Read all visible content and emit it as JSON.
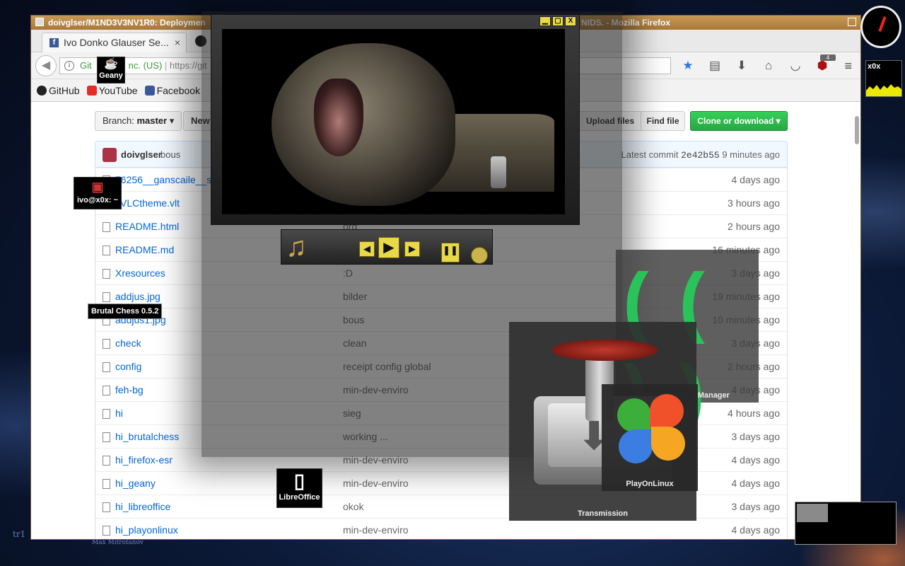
{
  "window": {
    "title_left": "doivglser/M1ND3V3NV1R0: Deploymen",
    "title_right": "NIDS. - Mozilla Firefox"
  },
  "tabs": [
    {
      "label": "Ivo Donko Glauser Se...",
      "close": "×"
    }
  ],
  "nav": {
    "back": "◀",
    "url_secure": "Git",
    "url_org": "nc. (US)",
    "url_text": "https://git",
    "info": "i"
  },
  "toolbar_icons": [
    "star-icon",
    "reader-icon",
    "download-icon",
    "home-icon",
    "pocket-icon",
    "ublock-icon"
  ],
  "ublock_badge": "4",
  "bookmarks": [
    {
      "label": "GitHub",
      "icon": "github-icon"
    },
    {
      "label": "YouTube",
      "icon": "youtube-icon"
    },
    {
      "label": "Facebook",
      "icon": "facebook-icon"
    }
  ],
  "repo": {
    "branch_label": "Branch:",
    "branch_name": "master",
    "new_label": "New",
    "upload_label": "Upload files",
    "find_label": "Find file",
    "clone_label": "Clone or download",
    "commit_author": "doivglser",
    "commit_msg": "bous",
    "latest_label": "Latest commit",
    "latest_sha": "2e42b55",
    "latest_age": "9 minutes ago",
    "files": [
      {
        "name": "76256__ganscaile__s",
        "msg": "",
        "age": "4 days ago"
      },
      {
        "name": "yVLCtheme.vlt",
        "msg": "",
        "age": "3 hours ago"
      },
      {
        "name": "README.html",
        "msg": "org",
        "age": "2 hours ago"
      },
      {
        "name": "README.md",
        "msg": "",
        "age": "16 minutes ago"
      },
      {
        "name": "Xresources",
        "msg": ":D",
        "age": "3 days ago"
      },
      {
        "name": "addjus.jpg",
        "msg": "bilder",
        "age": "19 minutes ago"
      },
      {
        "name": "addjus1.jpg",
        "msg": "bous",
        "age": "10 minutes ago"
      },
      {
        "name": "check",
        "msg": "clean",
        "age": "3 days ago"
      },
      {
        "name": "config",
        "msg": "receipt config global",
        "age": "2 hours ago"
      },
      {
        "name": "feh-bg",
        "msg": "min-dev-enviro",
        "age": "4 days ago"
      },
      {
        "name": "hi",
        "msg": "sieg",
        "age": "4 hours ago"
      },
      {
        "name": "hi_brutalchess",
        "msg": "working ...",
        "age": "3 days ago"
      },
      {
        "name": "hi_firefox-esr",
        "msg": "min-dev-enviro",
        "age": "4 days ago"
      },
      {
        "name": "hi_geany",
        "msg": "min-dev-enviro",
        "age": "4 days ago"
      },
      {
        "name": "hi_libreoffice",
        "msg": "okok",
        "age": "3 days ago"
      },
      {
        "name": "hi_playonlinux",
        "msg": "min-dev-enviro",
        "age": "4 days ago"
      }
    ]
  },
  "player": {
    "win_buttons": [
      "▁",
      "▢",
      "X"
    ],
    "note": "♫",
    "prev": "◀",
    "play": "▶",
    "next": "▶",
    "pause": "❚❚",
    "rec": ""
  },
  "launchers": {
    "geany": "Geany",
    "terminal": "ivo@x0x: ~",
    "libreoffice": "LibreOffice",
    "tooltip": "Brutal Chess 0.5.2",
    "wicd": "Wicd Network Manager",
    "transmission": "Transmission",
    "playonlinux": "PlayOnLinux"
  },
  "desktop": {
    "x0x_label": "x0x",
    "wall_text1": "tr1",
    "wall_text2": "Max Mitrofanov"
  },
  "colors": {
    "clone_green": "#28a745",
    "link_blue": "#0366d6",
    "player_yellow": "#e8d84a",
    "wicd_green": "#29c35a",
    "title_bar": "#b8874a"
  }
}
